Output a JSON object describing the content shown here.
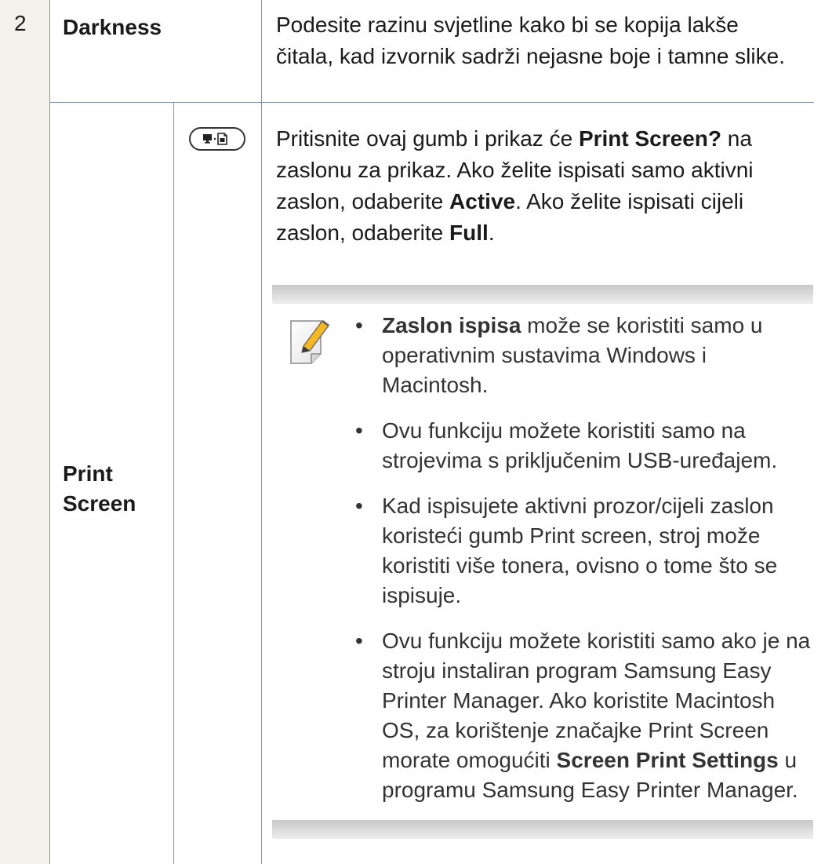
{
  "rows": [
    {
      "number": "2",
      "label": "Darkness",
      "description": "Podesite razinu svjetline kako bi se kopija lakše čitala, kad izvornik sadrži nejasne boje i tamne slike."
    },
    {
      "label": "Print Screen",
      "button_icon": "print-screen-button-icon",
      "description": {
        "p1": "Pritisnite ovaj gumb i prikaz će ",
        "b1": "Print Screen?",
        "p2": " na zaslonu za prikaz. Ako želite ispisati samo aktivni zaslon, odaberite ",
        "b2": "Active",
        "p3": ". Ako želite ispisati cijeli zaslon, odaberite ",
        "b3": "Full",
        "p4": "."
      }
    }
  ],
  "note": {
    "icon": "note-pencil-icon",
    "items": [
      {
        "b": "Zaslon ispisa",
        "t": " može se koristiti samo u operativnim sustavima Windows i Macintosh."
      },
      {
        "t": "Ovu funkciju možete koristiti samo na strojevima s priključenim USB-uređajem."
      },
      {
        "t": "Kad ispisujete aktivni prozor/cijeli zaslon koristeći gumb Print screen, stroj može koristiti više tonera, ovisno o tome što se ispisuje."
      },
      {
        "t1": "Ovu funkciju možete koristiti samo ako je na stroju instaliran program Samsung Easy Printer Manager. Ako koristite Macintosh OS, za korištenje značajke Print Screen morate omogućiti ",
        "b": "Screen Print Settings",
        "t2": " u programu Samsung Easy Printer Manager."
      }
    ]
  },
  "colors": {
    "grid_line": "#7f96ad",
    "row_number_bg": "#f2f1ea"
  }
}
